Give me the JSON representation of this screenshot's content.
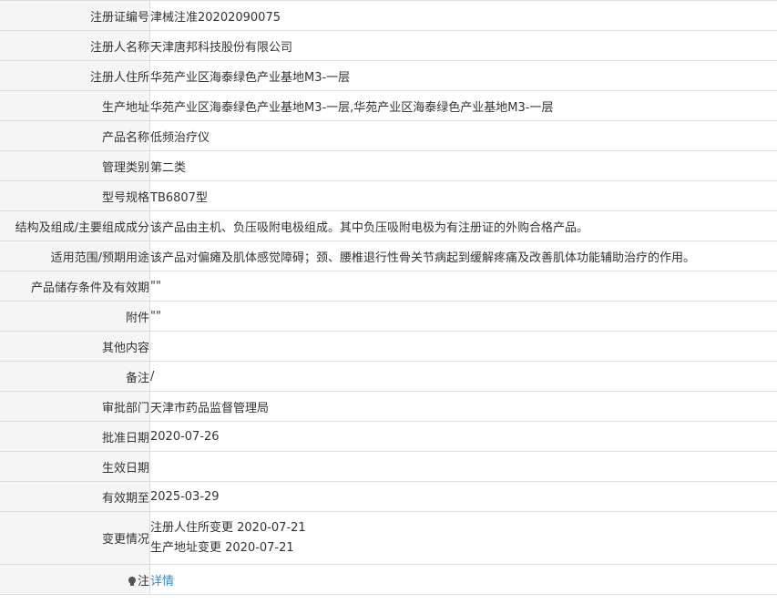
{
  "rows": [
    {
      "label": "注册证编号",
      "value": "津械注准20202090075"
    },
    {
      "label": "注册人名称",
      "value": "天津唐邦科技股份有限公司"
    },
    {
      "label": "注册人住所",
      "value": "华苑产业区海泰绿色产业基地M3-一层"
    },
    {
      "label": "生产地址",
      "value": "华苑产业区海泰绿色产业基地M3-一层,华苑产业区海泰绿色产业基地M3-一层"
    },
    {
      "label": "产品名称",
      "value": "低频治疗仪"
    },
    {
      "label": "管理类别",
      "value": "第二类"
    },
    {
      "label": "型号规格",
      "value": "TB6807型"
    },
    {
      "label": "结构及组成/主要组成成分",
      "value": "该产品由主机、负压吸附电极组成。其中负压吸附电极为有注册证的外购合格产品。"
    },
    {
      "label": "适用范围/预期用途",
      "value": "该产品对偏瘫及肌体感觉障碍；颈、腰椎退行性骨关节病起到缓解疼痛及改善肌体功能辅助治疗的作用。"
    },
    {
      "label": "产品储存条件及有效期",
      "value": "\"\""
    },
    {
      "label": "附件",
      "value": "\"\""
    },
    {
      "label": "其他内容",
      "value": ""
    },
    {
      "label": "备注",
      "value": "/"
    },
    {
      "label": "审批部门",
      "value": "天津市药品监督管理局"
    },
    {
      "label": "批准日期",
      "value": "2020-07-26"
    },
    {
      "label": "生效日期",
      "value": ""
    },
    {
      "label": "有效期至",
      "value": "2025-03-29"
    }
  ],
  "change": {
    "label": "变更情况",
    "lines": [
      "注册人住所变更 2020-07-21",
      "生产地址变更 2020-07-21"
    ]
  },
  "note": {
    "label": "注",
    "icon": "lightbulb-icon",
    "link_text": "详情"
  }
}
